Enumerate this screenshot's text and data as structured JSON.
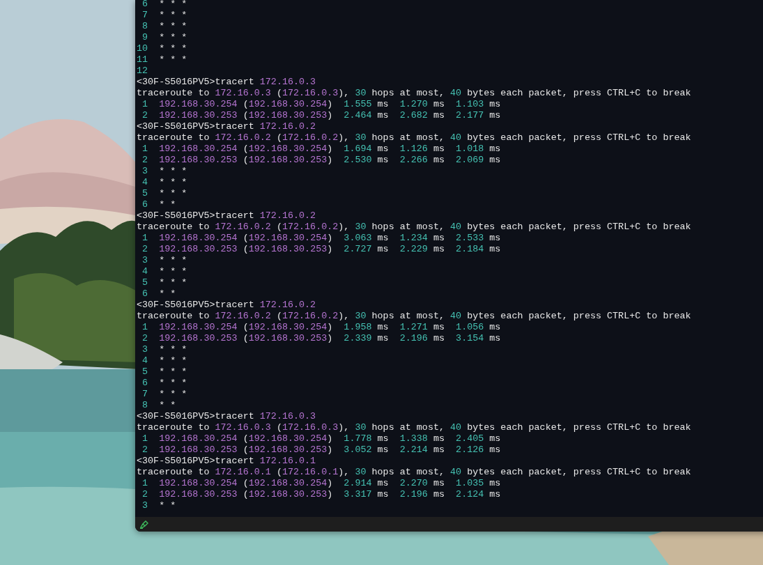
{
  "terminal": {
    "lines": [
      {
        "segments": [
          {
            "text": " 6",
            "kind": "num"
          },
          {
            "text": "  * * *",
            "kind": "plain"
          }
        ]
      },
      {
        "segments": [
          {
            "text": " 7",
            "kind": "num"
          },
          {
            "text": "  * * *",
            "kind": "plain"
          }
        ]
      },
      {
        "segments": [
          {
            "text": " 8",
            "kind": "num"
          },
          {
            "text": "  * * *",
            "kind": "plain"
          }
        ]
      },
      {
        "segments": [
          {
            "text": " 9",
            "kind": "num"
          },
          {
            "text": "  * * *",
            "kind": "plain"
          }
        ]
      },
      {
        "segments": [
          {
            "text": "10",
            "kind": "num"
          },
          {
            "text": "  * * *",
            "kind": "plain"
          }
        ]
      },
      {
        "segments": [
          {
            "text": "11",
            "kind": "num"
          },
          {
            "text": "  * * *",
            "kind": "plain"
          }
        ]
      },
      {
        "segments": [
          {
            "text": "12",
            "kind": "num"
          }
        ]
      },
      {
        "segments": [
          {
            "text": "<30F-S5016PV5>tracert ",
            "kind": "plain"
          },
          {
            "text": "172.16.0.3",
            "kind": "addr"
          }
        ]
      },
      {
        "segments": [
          {
            "text": "traceroute to ",
            "kind": "plain"
          },
          {
            "text": "172.16.0.3",
            "kind": "addr"
          },
          {
            "text": " (",
            "kind": "plain"
          },
          {
            "text": "172.16.0.3",
            "kind": "addr"
          },
          {
            "text": "), ",
            "kind": "plain"
          },
          {
            "text": "30",
            "kind": "num"
          },
          {
            "text": " hops at most, ",
            "kind": "plain"
          },
          {
            "text": "40",
            "kind": "num"
          },
          {
            "text": " bytes each packet, press CTRL+C to break",
            "kind": "plain"
          }
        ]
      },
      {
        "segments": [
          {
            "text": " 1  ",
            "kind": "num"
          },
          {
            "text": "192.168.30.254",
            "kind": "addr"
          },
          {
            "text": " (",
            "kind": "plain"
          },
          {
            "text": "192.168.30.254",
            "kind": "addr"
          },
          {
            "text": ")  ",
            "kind": "plain"
          },
          {
            "text": "1.555",
            "kind": "num"
          },
          {
            "text": " ms  ",
            "kind": "plain"
          },
          {
            "text": "1.270",
            "kind": "num"
          },
          {
            "text": " ms  ",
            "kind": "plain"
          },
          {
            "text": "1.103",
            "kind": "num"
          },
          {
            "text": " ms",
            "kind": "plain"
          }
        ]
      },
      {
        "segments": [
          {
            "text": " 2  ",
            "kind": "num"
          },
          {
            "text": "192.168.30.253",
            "kind": "addr"
          },
          {
            "text": " (",
            "kind": "plain"
          },
          {
            "text": "192.168.30.253",
            "kind": "addr"
          },
          {
            "text": ")  ",
            "kind": "plain"
          },
          {
            "text": "2.464",
            "kind": "num"
          },
          {
            "text": " ms  ",
            "kind": "plain"
          },
          {
            "text": "2.682",
            "kind": "num"
          },
          {
            "text": " ms  ",
            "kind": "plain"
          },
          {
            "text": "2.177",
            "kind": "num"
          },
          {
            "text": " ms",
            "kind": "plain"
          }
        ]
      },
      {
        "segments": [
          {
            "text": "<30F-S5016PV5>tracert ",
            "kind": "plain"
          },
          {
            "text": "172.16.0.2",
            "kind": "addr"
          }
        ]
      },
      {
        "segments": [
          {
            "text": "traceroute to ",
            "kind": "plain"
          },
          {
            "text": "172.16.0.2",
            "kind": "addr"
          },
          {
            "text": " (",
            "kind": "plain"
          },
          {
            "text": "172.16.0.2",
            "kind": "addr"
          },
          {
            "text": "), ",
            "kind": "plain"
          },
          {
            "text": "30",
            "kind": "num"
          },
          {
            "text": " hops at most, ",
            "kind": "plain"
          },
          {
            "text": "40",
            "kind": "num"
          },
          {
            "text": " bytes each packet, press CTRL+C to break",
            "kind": "plain"
          }
        ]
      },
      {
        "segments": [
          {
            "text": " 1  ",
            "kind": "num"
          },
          {
            "text": "192.168.30.254",
            "kind": "addr"
          },
          {
            "text": " (",
            "kind": "plain"
          },
          {
            "text": "192.168.30.254",
            "kind": "addr"
          },
          {
            "text": ")  ",
            "kind": "plain"
          },
          {
            "text": "1.694",
            "kind": "num"
          },
          {
            "text": " ms  ",
            "kind": "plain"
          },
          {
            "text": "1.126",
            "kind": "num"
          },
          {
            "text": " ms  ",
            "kind": "plain"
          },
          {
            "text": "1.018",
            "kind": "num"
          },
          {
            "text": " ms",
            "kind": "plain"
          }
        ]
      },
      {
        "segments": [
          {
            "text": " 2  ",
            "kind": "num"
          },
          {
            "text": "192.168.30.253",
            "kind": "addr"
          },
          {
            "text": " (",
            "kind": "plain"
          },
          {
            "text": "192.168.30.253",
            "kind": "addr"
          },
          {
            "text": ")  ",
            "kind": "plain"
          },
          {
            "text": "2.530",
            "kind": "num"
          },
          {
            "text": " ms  ",
            "kind": "plain"
          },
          {
            "text": "2.266",
            "kind": "num"
          },
          {
            "text": " ms  ",
            "kind": "plain"
          },
          {
            "text": "2.069",
            "kind": "num"
          },
          {
            "text": " ms",
            "kind": "plain"
          }
        ]
      },
      {
        "segments": [
          {
            "text": " 3",
            "kind": "num"
          },
          {
            "text": "  * * *",
            "kind": "plain"
          }
        ]
      },
      {
        "segments": [
          {
            "text": " 4",
            "kind": "num"
          },
          {
            "text": "  * * *",
            "kind": "plain"
          }
        ]
      },
      {
        "segments": [
          {
            "text": " 5",
            "kind": "num"
          },
          {
            "text": "  * * *",
            "kind": "plain"
          }
        ]
      },
      {
        "segments": [
          {
            "text": " 6",
            "kind": "num"
          },
          {
            "text": "  * *",
            "kind": "plain"
          }
        ]
      },
      {
        "segments": [
          {
            "text": "<30F-S5016PV5>tracert ",
            "kind": "plain"
          },
          {
            "text": "172.16.0.2",
            "kind": "addr"
          }
        ]
      },
      {
        "segments": [
          {
            "text": "traceroute to ",
            "kind": "plain"
          },
          {
            "text": "172.16.0.2",
            "kind": "addr"
          },
          {
            "text": " (",
            "kind": "plain"
          },
          {
            "text": "172.16.0.2",
            "kind": "addr"
          },
          {
            "text": "), ",
            "kind": "plain"
          },
          {
            "text": "30",
            "kind": "num"
          },
          {
            "text": " hops at most, ",
            "kind": "plain"
          },
          {
            "text": "40",
            "kind": "num"
          },
          {
            "text": " bytes each packet, press CTRL+C to break",
            "kind": "plain"
          }
        ]
      },
      {
        "segments": [
          {
            "text": " 1  ",
            "kind": "num"
          },
          {
            "text": "192.168.30.254",
            "kind": "addr"
          },
          {
            "text": " (",
            "kind": "plain"
          },
          {
            "text": "192.168.30.254",
            "kind": "addr"
          },
          {
            "text": ")  ",
            "kind": "plain"
          },
          {
            "text": "3.063",
            "kind": "num"
          },
          {
            "text": " ms  ",
            "kind": "plain"
          },
          {
            "text": "1.234",
            "kind": "num"
          },
          {
            "text": " ms  ",
            "kind": "plain"
          },
          {
            "text": "2.533",
            "kind": "num"
          },
          {
            "text": " ms",
            "kind": "plain"
          }
        ]
      },
      {
        "segments": [
          {
            "text": " 2  ",
            "kind": "num"
          },
          {
            "text": "192.168.30.253",
            "kind": "addr"
          },
          {
            "text": " (",
            "kind": "plain"
          },
          {
            "text": "192.168.30.253",
            "kind": "addr"
          },
          {
            "text": ")  ",
            "kind": "plain"
          },
          {
            "text": "2.727",
            "kind": "num"
          },
          {
            "text": " ms  ",
            "kind": "plain"
          },
          {
            "text": "2.229",
            "kind": "num"
          },
          {
            "text": " ms  ",
            "kind": "plain"
          },
          {
            "text": "2.184",
            "kind": "num"
          },
          {
            "text": " ms",
            "kind": "plain"
          }
        ]
      },
      {
        "segments": [
          {
            "text": " 3",
            "kind": "num"
          },
          {
            "text": "  * * *",
            "kind": "plain"
          }
        ]
      },
      {
        "segments": [
          {
            "text": " 4",
            "kind": "num"
          },
          {
            "text": "  * * *",
            "kind": "plain"
          }
        ]
      },
      {
        "segments": [
          {
            "text": " 5",
            "kind": "num"
          },
          {
            "text": "  * * *",
            "kind": "plain"
          }
        ]
      },
      {
        "segments": [
          {
            "text": " 6",
            "kind": "num"
          },
          {
            "text": "  * *",
            "kind": "plain"
          }
        ]
      },
      {
        "segments": [
          {
            "text": "<30F-S5016PV5>tracert ",
            "kind": "plain"
          },
          {
            "text": "172.16.0.2",
            "kind": "addr"
          }
        ]
      },
      {
        "segments": [
          {
            "text": "traceroute to ",
            "kind": "plain"
          },
          {
            "text": "172.16.0.2",
            "kind": "addr"
          },
          {
            "text": " (",
            "kind": "plain"
          },
          {
            "text": "172.16.0.2",
            "kind": "addr"
          },
          {
            "text": "), ",
            "kind": "plain"
          },
          {
            "text": "30",
            "kind": "num"
          },
          {
            "text": " hops at most, ",
            "kind": "plain"
          },
          {
            "text": "40",
            "kind": "num"
          },
          {
            "text": " bytes each packet, press CTRL+C to break",
            "kind": "plain"
          }
        ]
      },
      {
        "segments": [
          {
            "text": " 1  ",
            "kind": "num"
          },
          {
            "text": "192.168.30.254",
            "kind": "addr"
          },
          {
            "text": " (",
            "kind": "plain"
          },
          {
            "text": "192.168.30.254",
            "kind": "addr"
          },
          {
            "text": ")  ",
            "kind": "plain"
          },
          {
            "text": "1.958",
            "kind": "num"
          },
          {
            "text": " ms  ",
            "kind": "plain"
          },
          {
            "text": "1.271",
            "kind": "num"
          },
          {
            "text": " ms  ",
            "kind": "plain"
          },
          {
            "text": "1.056",
            "kind": "num"
          },
          {
            "text": " ms",
            "kind": "plain"
          }
        ]
      },
      {
        "segments": [
          {
            "text": " 2  ",
            "kind": "num"
          },
          {
            "text": "192.168.30.253",
            "kind": "addr"
          },
          {
            "text": " (",
            "kind": "plain"
          },
          {
            "text": "192.168.30.253",
            "kind": "addr"
          },
          {
            "text": ")  ",
            "kind": "plain"
          },
          {
            "text": "2.339",
            "kind": "num"
          },
          {
            "text": " ms  ",
            "kind": "plain"
          },
          {
            "text": "2.196",
            "kind": "num"
          },
          {
            "text": " ms  ",
            "kind": "plain"
          },
          {
            "text": "3.154",
            "kind": "num"
          },
          {
            "text": " ms",
            "kind": "plain"
          }
        ]
      },
      {
        "segments": [
          {
            "text": " 3",
            "kind": "num"
          },
          {
            "text": "  * * *",
            "kind": "plain"
          }
        ]
      },
      {
        "segments": [
          {
            "text": " 4",
            "kind": "num"
          },
          {
            "text": "  * * *",
            "kind": "plain"
          }
        ]
      },
      {
        "segments": [
          {
            "text": " 5",
            "kind": "num"
          },
          {
            "text": "  * * *",
            "kind": "plain"
          }
        ]
      },
      {
        "segments": [
          {
            "text": " 6",
            "kind": "num"
          },
          {
            "text": "  * * *",
            "kind": "plain"
          }
        ]
      },
      {
        "segments": [
          {
            "text": " 7",
            "kind": "num"
          },
          {
            "text": "  * * *",
            "kind": "plain"
          }
        ]
      },
      {
        "segments": [
          {
            "text": " 8",
            "kind": "num"
          },
          {
            "text": "  * *",
            "kind": "plain"
          }
        ]
      },
      {
        "segments": [
          {
            "text": "<30F-S5016PV5>tracert ",
            "kind": "plain"
          },
          {
            "text": "172.16.0.3",
            "kind": "addr"
          }
        ]
      },
      {
        "segments": [
          {
            "text": "traceroute to ",
            "kind": "plain"
          },
          {
            "text": "172.16.0.3",
            "kind": "addr"
          },
          {
            "text": " (",
            "kind": "plain"
          },
          {
            "text": "172.16.0.3",
            "kind": "addr"
          },
          {
            "text": "), ",
            "kind": "plain"
          },
          {
            "text": "30",
            "kind": "num"
          },
          {
            "text": " hops at most, ",
            "kind": "plain"
          },
          {
            "text": "40",
            "kind": "num"
          },
          {
            "text": " bytes each packet, press CTRL+C to break",
            "kind": "plain"
          }
        ]
      },
      {
        "segments": [
          {
            "text": " 1  ",
            "kind": "num"
          },
          {
            "text": "192.168.30.254",
            "kind": "addr"
          },
          {
            "text": " (",
            "kind": "plain"
          },
          {
            "text": "192.168.30.254",
            "kind": "addr"
          },
          {
            "text": ")  ",
            "kind": "plain"
          },
          {
            "text": "1.778",
            "kind": "num"
          },
          {
            "text": " ms  ",
            "kind": "plain"
          },
          {
            "text": "1.338",
            "kind": "num"
          },
          {
            "text": " ms  ",
            "kind": "plain"
          },
          {
            "text": "2.405",
            "kind": "num"
          },
          {
            "text": " ms",
            "kind": "plain"
          }
        ]
      },
      {
        "segments": [
          {
            "text": " 2  ",
            "kind": "num"
          },
          {
            "text": "192.168.30.253",
            "kind": "addr"
          },
          {
            "text": " (",
            "kind": "plain"
          },
          {
            "text": "192.168.30.253",
            "kind": "addr"
          },
          {
            "text": ")  ",
            "kind": "plain"
          },
          {
            "text": "3.052",
            "kind": "num"
          },
          {
            "text": " ms  ",
            "kind": "plain"
          },
          {
            "text": "2.214",
            "kind": "num"
          },
          {
            "text": " ms  ",
            "kind": "plain"
          },
          {
            "text": "2.126",
            "kind": "num"
          },
          {
            "text": " ms",
            "kind": "plain"
          }
        ]
      },
      {
        "segments": [
          {
            "text": "<30F-S5016PV5>tracert ",
            "kind": "plain"
          },
          {
            "text": "172.16.0.1",
            "kind": "addr"
          }
        ]
      },
      {
        "segments": [
          {
            "text": "traceroute to ",
            "kind": "plain"
          },
          {
            "text": "172.16.0.1",
            "kind": "addr"
          },
          {
            "text": " (",
            "kind": "plain"
          },
          {
            "text": "172.16.0.1",
            "kind": "addr"
          },
          {
            "text": "), ",
            "kind": "plain"
          },
          {
            "text": "30",
            "kind": "num"
          },
          {
            "text": " hops at most, ",
            "kind": "plain"
          },
          {
            "text": "40",
            "kind": "num"
          },
          {
            "text": " bytes each packet, press CTRL+C to break",
            "kind": "plain"
          }
        ]
      },
      {
        "segments": [
          {
            "text": " 1  ",
            "kind": "num"
          },
          {
            "text": "192.168.30.254",
            "kind": "addr"
          },
          {
            "text": " (",
            "kind": "plain"
          },
          {
            "text": "192.168.30.254",
            "kind": "addr"
          },
          {
            "text": ")  ",
            "kind": "plain"
          },
          {
            "text": "2.914",
            "kind": "num"
          },
          {
            "text": " ms  ",
            "kind": "plain"
          },
          {
            "text": "2.270",
            "kind": "num"
          },
          {
            "text": " ms  ",
            "kind": "plain"
          },
          {
            "text": "1.035",
            "kind": "num"
          },
          {
            "text": " ms",
            "kind": "plain"
          }
        ]
      },
      {
        "segments": [
          {
            "text": " 2  ",
            "kind": "num"
          },
          {
            "text": "192.168.30.253",
            "kind": "addr"
          },
          {
            "text": " (",
            "kind": "plain"
          },
          {
            "text": "192.168.30.253",
            "kind": "addr"
          },
          {
            "text": ")  ",
            "kind": "plain"
          },
          {
            "text": "3.317",
            "kind": "num"
          },
          {
            "text": " ms  ",
            "kind": "plain"
          },
          {
            "text": "2.196",
            "kind": "num"
          },
          {
            "text": " ms  ",
            "kind": "plain"
          },
          {
            "text": "2.124",
            "kind": "num"
          },
          {
            "text": " ms",
            "kind": "plain"
          }
        ]
      },
      {
        "segments": [
          {
            "text": " 3",
            "kind": "num"
          },
          {
            "text": "  * *",
            "kind": "plain"
          }
        ]
      }
    ]
  }
}
